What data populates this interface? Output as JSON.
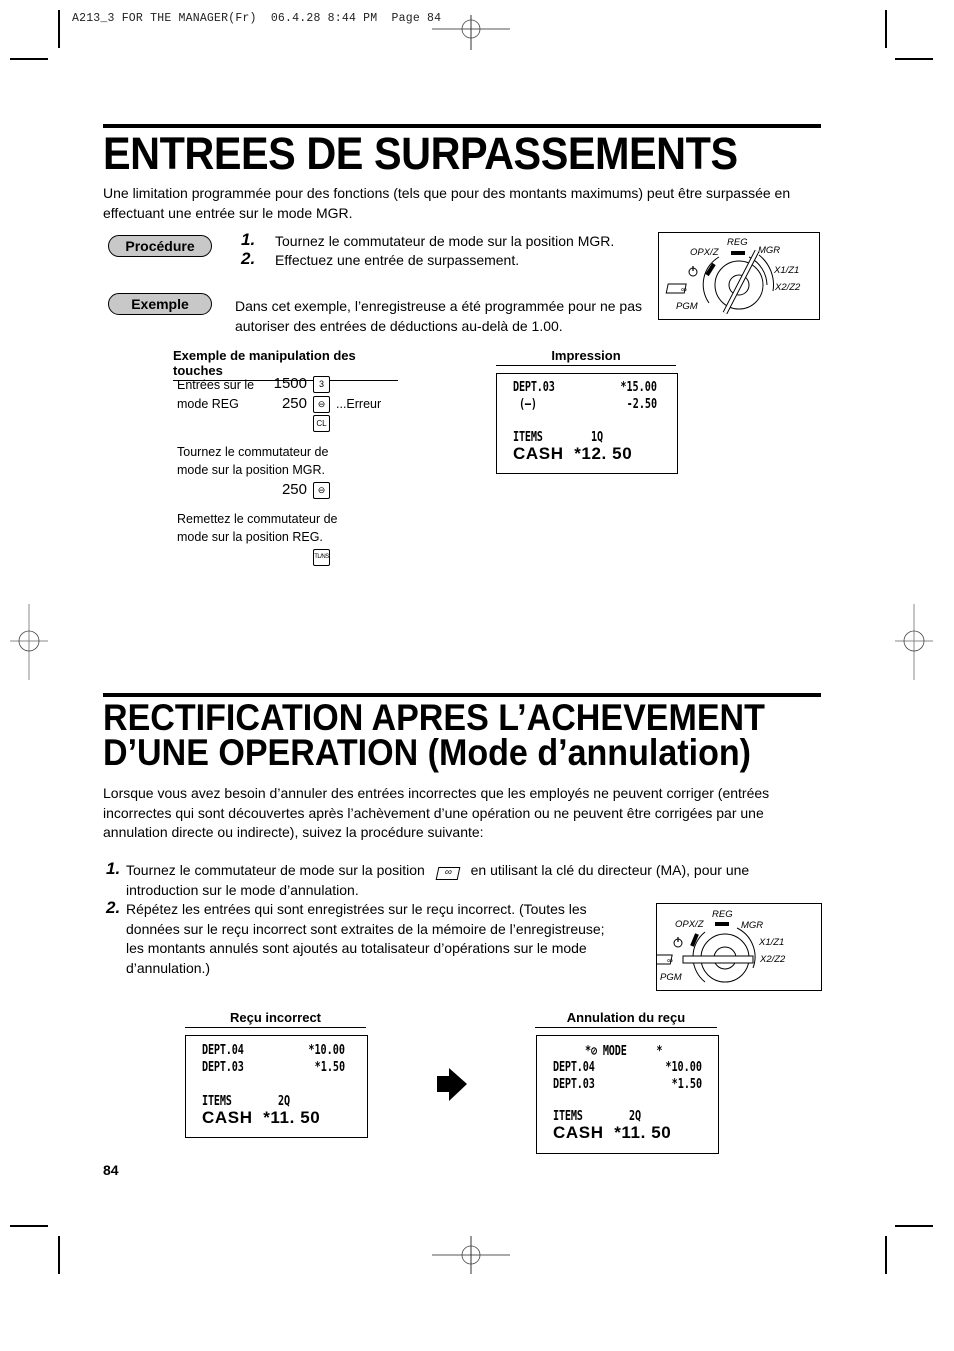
{
  "slug": "A213_3 FOR THE MANAGER(Fr)  06.4.28 8:44 PM  Page 84",
  "section1": {
    "title": "ENTREES DE SURPASSEMENTS",
    "intro": "Une limitation programmée pour des fonctions (tels que pour des montants maximums) peut être surpassée en effectuant une entrée sur le mode MGR.",
    "procedure_label": "Procédure",
    "steps": [
      {
        "num": "1.",
        "text": "Tournez le commutateur de mode sur la position MGR."
      },
      {
        "num": "2.",
        "text": "Effectuez une entrée de surpassement."
      }
    ],
    "example_label": "Exemple",
    "example_text": "Dans cet exemple, l’enregistreuse a été programmée pour ne pas autoriser des entrées de déductions au-delà de 1.00.",
    "key_ops": {
      "heading": "Exemple de manipulation des touches",
      "reg_label_1": "Entrées sur le",
      "reg_label_2": "mode REG",
      "entries": [
        {
          "value": "1500",
          "key": "3"
        },
        {
          "value": "250",
          "key": "⊖",
          "note": "...Erreur"
        },
        {
          "value": "",
          "key": "CL"
        }
      ],
      "mgr_text_1": "Tournez le commutateur de",
      "mgr_text_2": "mode sur la position MGR.",
      "mgr_entry": {
        "value": "250",
        "key": "⊖"
      },
      "reg_text_1": "Remettez le commutateur de",
      "reg_text_2": "mode sur la position REG.",
      "final_key": "TL/NS"
    },
    "impression": {
      "heading": "Impression",
      "lines": [
        {
          "left": "DEPT.03",
          "right": "*15.00"
        },
        {
          "left": " (—)",
          "right": "-2.50"
        }
      ],
      "items": {
        "label": "ITEMS",
        "qty": "1Q"
      },
      "total": "CASH  *12. 50"
    },
    "dial": {
      "labels": [
        "REG",
        "OPX/Z",
        "MGR",
        "X1/Z1",
        "X2/Z2",
        "PGM"
      ],
      "position": "MGR"
    }
  },
  "section2": {
    "title_line1": "RECTIFICATION APRES L’ACHEVEMENT",
    "title_line2": "D’UNE OPERATION  (Mode d’annulation)",
    "intro": "Lorsque vous avez besoin d’annuler des entrées incorrectes que les employés ne peuvent corriger (entrées incorrectes qui sont découvertes après l’achèvement d’une opération ou ne peuvent être corrigées par une annulation directe ou indirecte), suivez la procédure suivante:",
    "steps": [
      {
        "num": "1.",
        "text_a": "Tournez le commutateur de mode sur la position",
        "text_b": "en utilisant la clé du directeur (MA), pour une introduction sur le mode d’annulation."
      },
      {
        "num": "2.",
        "text": "Répétez les entrées qui sont enregistrées sur le reçu incorrect. (Toutes les données sur le reçu incorrect sont extraites de la mémoire de l’enregistreuse; les montants annulés sont ajoutés au totalisateur d’opérations sur le mode d’annulation.)"
      }
    ],
    "dial": {
      "labels": [
        "REG",
        "OPX/Z",
        "MGR",
        "X1/Z1",
        "X2/Z2",
        "PGM"
      ],
      "position": "VOID"
    },
    "receipt_incorrect": {
      "heading": "Reçu incorrect",
      "lines": [
        {
          "left": "DEPT.04",
          "right": "*10.00"
        },
        {
          "left": "DEPT.03",
          "right": "*1.50"
        }
      ],
      "items": {
        "label": "ITEMS",
        "qty": "2Q"
      },
      "total": "CASH  *11. 50"
    },
    "receipt_void": {
      "heading": "Annulation du reçu",
      "mode_line": "*⊘ MODE     *",
      "lines": [
        {
          "left": "DEPT.04",
          "right": "*10.00"
        },
        {
          "left": "DEPT.03",
          "right": "*1.50"
        }
      ],
      "items": {
        "label": "ITEMS",
        "qty": "2Q"
      },
      "total": "CASH  *11. 50"
    }
  },
  "page_number": "84"
}
